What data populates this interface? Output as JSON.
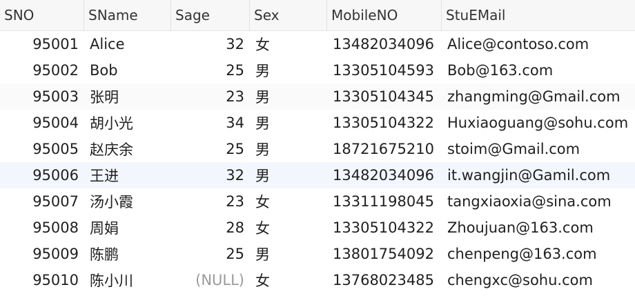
{
  "columns": [
    "SNO",
    "SName",
    "Sage",
    "Sex",
    "MobileNO",
    "StuEMail"
  ],
  "rows": [
    {
      "sno": "95001",
      "sname": "Alice",
      "sage": "32",
      "sex": "女",
      "mobile": "13482034096",
      "email": "Alice@contoso.com"
    },
    {
      "sno": "95002",
      "sname": "Bob",
      "sage": "25",
      "sex": "男",
      "mobile": "13305104593",
      "email": "Bob@163.com"
    },
    {
      "sno": "95003",
      "sname": "张明",
      "sage": "23",
      "sex": "男",
      "mobile": "13305104345",
      "email": "zhangming@Gmail.com"
    },
    {
      "sno": "95004",
      "sname": "胡小光",
      "sage": "34",
      "sex": "男",
      "mobile": "13305104322",
      "email": "Huxiaoguang@sohu.com"
    },
    {
      "sno": "95005",
      "sname": "赵庆余",
      "sage": "25",
      "sex": "男",
      "mobile": "18721675210",
      "email": "stoim@Gmail.com"
    },
    {
      "sno": "95006",
      "sname": "王进",
      "sage": "32",
      "sex": "男",
      "mobile": "13482034096",
      "email": "it.wangjin@Gamil.com"
    },
    {
      "sno": "95007",
      "sname": "汤小霞",
      "sage": "23",
      "sex": "女",
      "mobile": "13311198045",
      "email": "tangxiaoxia@sina.com"
    },
    {
      "sno": "95008",
      "sname": "周娟",
      "sage": "28",
      "sex": "女",
      "mobile": "13305104322",
      "email": "Zhoujuan@163.com"
    },
    {
      "sno": "95009",
      "sname": "陈鹏",
      "sage": "25",
      "sex": "男",
      "mobile": "13801754092",
      "email": "chenpeng@163.com"
    },
    {
      "sno": "95010",
      "sname": "陈小川",
      "sage": "(NULL)",
      "sex": "女",
      "mobile": "13768023485",
      "email": "chengxc@sohu.com"
    }
  ]
}
